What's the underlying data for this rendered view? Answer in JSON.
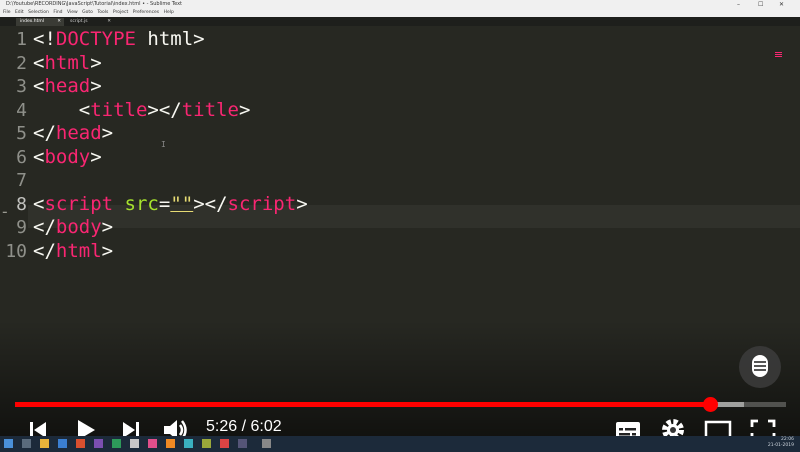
{
  "window": {
    "title": "D:\\Youtube\\RECORDING\\JavaScript\\Tutorial\\index.html • - Sublime Text",
    "controls": [
      "–",
      "☐",
      "✕"
    ]
  },
  "menu": [
    "File",
    "Edit",
    "Selection",
    "Find",
    "View",
    "Goto",
    "Tools",
    "Project",
    "Preferences",
    "Help"
  ],
  "tabs": [
    {
      "label": "index.html",
      "close": "✕",
      "active": true
    },
    {
      "label": "script.js",
      "close": "✕",
      "active": false
    }
  ],
  "editor": {
    "current_line": 8,
    "current_line_marker": "-",
    "lines": [
      {
        "num": "1",
        "tokens": [
          {
            "c": "p",
            "v": "<!"
          },
          {
            "c": "t",
            "v": "DOCTYPE"
          },
          {
            "c": "p",
            "v": " html>"
          }
        ]
      },
      {
        "num": "2",
        "tokens": [
          {
            "c": "p",
            "v": "<"
          },
          {
            "c": "t",
            "v": "html"
          },
          {
            "c": "p",
            "v": ">"
          }
        ]
      },
      {
        "num": "3",
        "tokens": [
          {
            "c": "p",
            "v": "<"
          },
          {
            "c": "t",
            "v": "head"
          },
          {
            "c": "p",
            "v": ">"
          }
        ]
      },
      {
        "num": "4",
        "tokens": [
          {
            "c": "p",
            "v": "    <"
          },
          {
            "c": "t",
            "v": "title"
          },
          {
            "c": "p",
            "v": "></"
          },
          {
            "c": "t",
            "v": "title"
          },
          {
            "c": "p",
            "v": ">"
          }
        ]
      },
      {
        "num": "5",
        "tokens": [
          {
            "c": "p",
            "v": "</"
          },
          {
            "c": "t",
            "v": "head"
          },
          {
            "c": "p",
            "v": ">"
          }
        ]
      },
      {
        "num": "6",
        "tokens": [
          {
            "c": "p",
            "v": "<"
          },
          {
            "c": "t",
            "v": "body"
          },
          {
            "c": "p",
            "v": ">"
          }
        ]
      },
      {
        "num": "7",
        "tokens": []
      },
      {
        "num": "8",
        "tokens": [
          {
            "c": "p",
            "v": "<"
          },
          {
            "c": "t",
            "v": "script"
          },
          {
            "c": "p",
            "v": " "
          },
          {
            "c": "a",
            "v": "src"
          },
          {
            "c": "p",
            "v": "="
          },
          {
            "c": "s quote",
            "v": "\"\""
          },
          {
            "c": "p",
            "v": "></"
          },
          {
            "c": "t",
            "v": "script"
          },
          {
            "c": "p",
            "v": ">"
          }
        ]
      },
      {
        "num": "9",
        "tokens": [
          {
            "c": "p",
            "v": "</"
          },
          {
            "c": "t",
            "v": "body"
          },
          {
            "c": "p",
            "v": ">"
          }
        ]
      },
      {
        "num": "10",
        "tokens": [
          {
            "c": "p",
            "v": "</"
          },
          {
            "c": "t",
            "v": "html"
          },
          {
            "c": "p",
            "v": ">"
          }
        ]
      }
    ]
  },
  "player": {
    "current_time": "5:26",
    "separator": " / ",
    "duration": "6:02",
    "timer_text": "5:26 / 6:02",
    "played_fraction": 0.902,
    "buffered_fraction": 0.945,
    "icons": {
      "previous": "skip-previous-icon",
      "play": "play-icon",
      "next": "skip-next-icon",
      "volume": "volume-icon",
      "subtitles": "subtitles-icon",
      "settings": "settings-gear-icon",
      "theater": "theater-mode-icon",
      "fullscreen": "fullscreen-icon",
      "mic": "microphone-icon"
    }
  },
  "taskbar": {
    "time": "22:06",
    "date": "21-01-2019"
  },
  "colors": {
    "editor_bg": "#272822",
    "tag": "#f92672",
    "attr": "#a6e22e",
    "string": "#e6db74",
    "punct": "#f8f8f2",
    "progress_played": "#ff0000"
  }
}
